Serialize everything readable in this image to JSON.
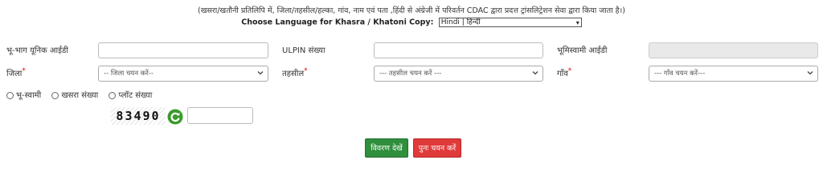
{
  "header": {
    "note": "(खसरा/खतौनी प्रतिलिपि में, जिला/तहसील/हल्का, गांव, नाम एवं पता ,हिंदी से अंग्रेजी में परिवर्तन CDAC द्वारा प्रदत्त ट्रांसलिट्रेशन सेवा द्वारा किया जाता है।)",
    "language_label": "Choose Language for Khasra / Khatoni Copy:",
    "language_selected": "Hindi | हिन्दी"
  },
  "fields": {
    "bhu_bhag_label": "भू-भाग यूनिक आईडी",
    "ulpin_label": "ULPIN संख्या",
    "bhoomiswami_label": "भूमिस्वामी आईडी",
    "district_label": "जिला",
    "district_placeholder": "-- जिला चयन करें--",
    "tehsil_label": "तहसील",
    "tehsil_placeholder": "--- तहसील चयन करें ---",
    "village_label": "गाँव",
    "village_placeholder": "--- गाँव चयन करें---",
    "required_mark": "*"
  },
  "search_by": {
    "options": [
      "भू-स्वामी",
      "खसरा संख्या",
      "प्लॉट संख्या"
    ]
  },
  "captcha": {
    "code": "83490",
    "input_value": ""
  },
  "buttons": {
    "view_details": "विवरण देखें",
    "reselect": "पुनः चयन करें"
  },
  "colors": {
    "view_button": "#2f8f3c",
    "reset_button": "#e03a3a",
    "refresh_icon": "#3a9a2a",
    "required_mark": "#dd0000"
  },
  "icons": {
    "refresh": "refresh-icon",
    "dropdown": "chevron-down-icon"
  }
}
